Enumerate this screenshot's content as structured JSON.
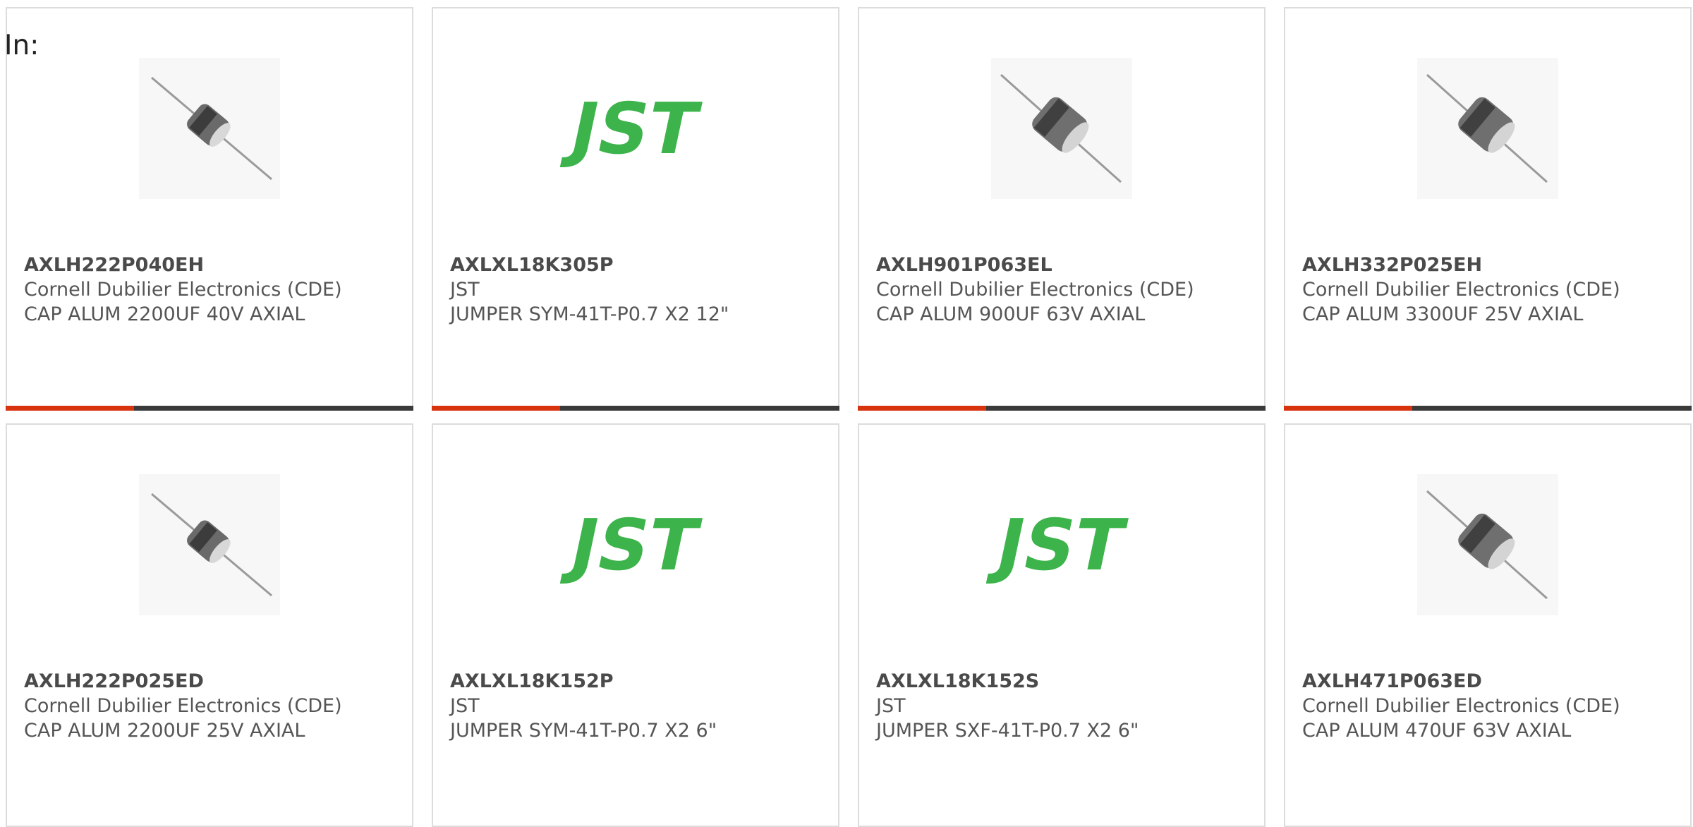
{
  "filter_label": "In:",
  "accent_color": "#d7330f",
  "bar_color": "#3a3a3a",
  "products": [
    {
      "part_number": "AXLH222P040EH",
      "manufacturer": "Cornell Dubilier Electronics (CDE)",
      "description": "CAP ALUM 2200UF 40V AXIAL",
      "image": "axial-capacitor-small-image"
    },
    {
      "part_number": "AXLXL18K305P",
      "manufacturer": "JST",
      "description": "JUMPER SYM-41T-P0.7 X2 12\"",
      "image": "jst-logo-image"
    },
    {
      "part_number": "AXLH901P063EL",
      "manufacturer": "Cornell Dubilier Electronics (CDE)",
      "description": "CAP ALUM 900UF 63V AXIAL",
      "image": "axial-capacitor-large-image"
    },
    {
      "part_number": "AXLH332P025EH",
      "manufacturer": "Cornell Dubilier Electronics (CDE)",
      "description": "CAP ALUM 3300UF 25V AXIAL",
      "image": "axial-capacitor-large-image"
    },
    {
      "part_number": "AXLH222P025ED",
      "manufacturer": "Cornell Dubilier Electronics (CDE)",
      "description": "CAP ALUM 2200UF 25V AXIAL",
      "image": "axial-capacitor-small-image"
    },
    {
      "part_number": "AXLXL18K152P",
      "manufacturer": "JST",
      "description": "JUMPER SYM-41T-P0.7 X2 6\"",
      "image": "jst-logo-image"
    },
    {
      "part_number": "AXLXL18K152S",
      "manufacturer": "JST",
      "description": "JUMPER SXF-41T-P0.7 X2 6\"",
      "image": "jst-logo-image"
    },
    {
      "part_number": "AXLH471P063ED",
      "manufacturer": "Cornell Dubilier Electronics (CDE)",
      "description": "CAP ALUM 470UF 63V AXIAL",
      "image": "axial-capacitor-large-image"
    }
  ]
}
